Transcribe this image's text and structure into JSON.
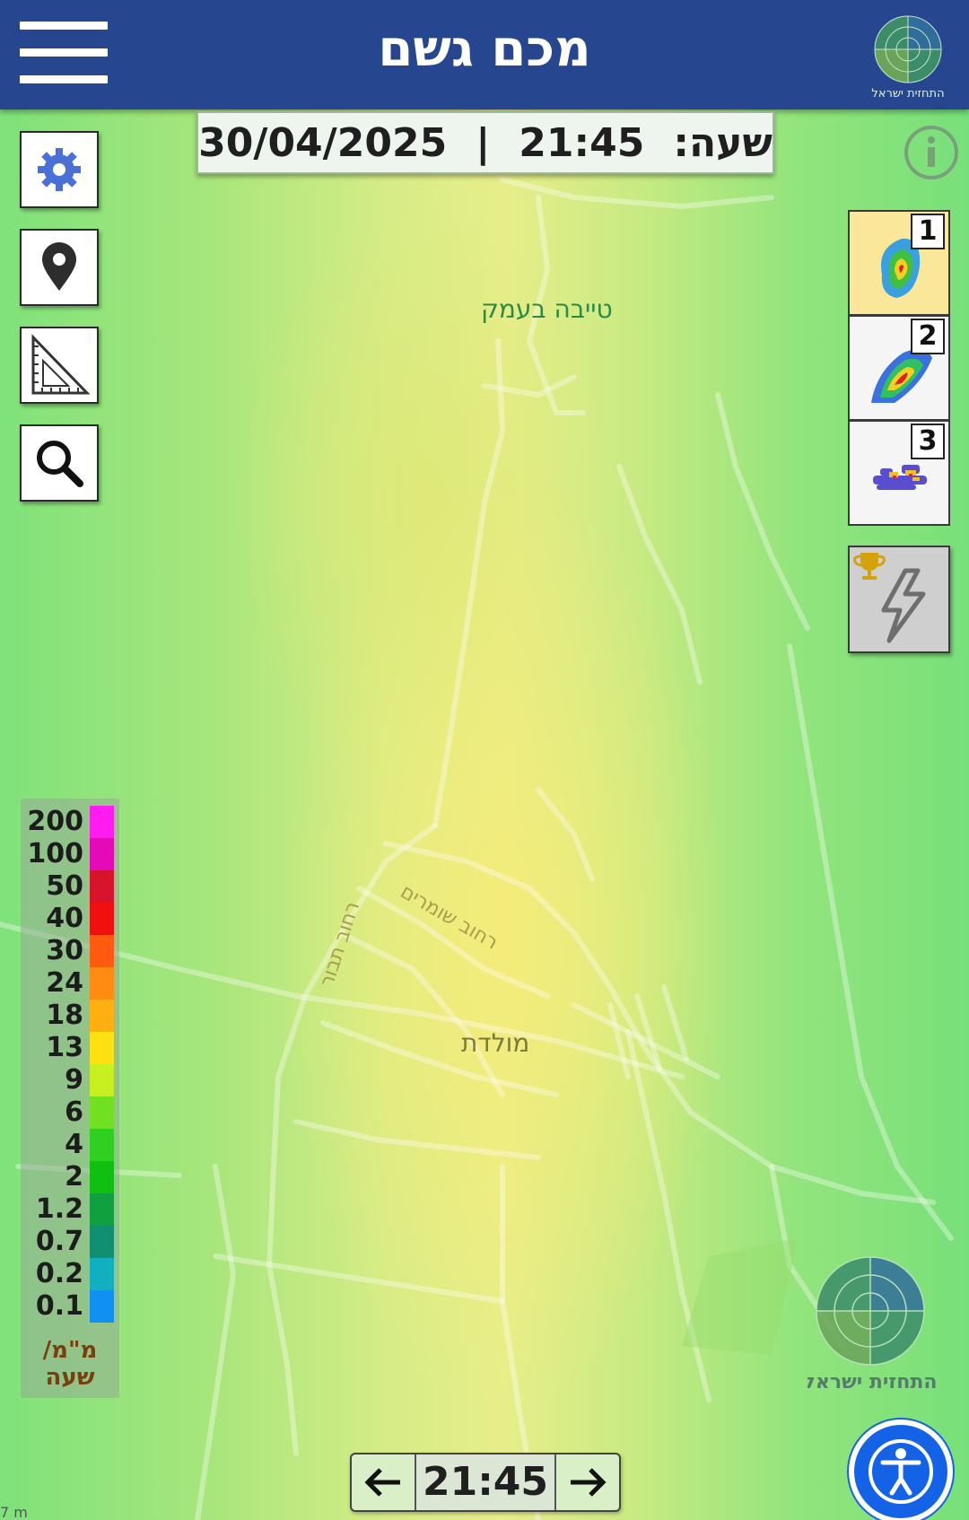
{
  "header": {
    "title": "מכם גשם",
    "logo_text": "התחזית ישראל"
  },
  "time_banner": {
    "hour_label": "שעה:",
    "time": "21:45",
    "separator": "|",
    "date": "30/04/2025"
  },
  "map": {
    "places": [
      {
        "label": "טייבה בעמק"
      },
      {
        "label": "מולדת"
      },
      {
        "label": "רחוב שומרים"
      },
      {
        "label": "רחוב תבור"
      }
    ],
    "scale_text": "7 m"
  },
  "tools": {
    "settings": "gear-icon",
    "location": "map-pin-icon",
    "measure": "ruler-triangle-icon",
    "search": "magnifier-icon"
  },
  "layers": [
    {
      "number": "1",
      "icon": "radar-map-icon",
      "selected": true
    },
    {
      "number": "2",
      "icon": "rain-map-icon",
      "selected": false
    },
    {
      "number": "3",
      "icon": "satellite-map-icon",
      "selected": false
    }
  ],
  "lightning": {
    "icon": "lightning-icon",
    "badge_icon": "trophy-icon"
  },
  "legend": {
    "values": [
      "200",
      "100",
      "50",
      "40",
      "30",
      "24",
      "18",
      "13",
      "9",
      "6",
      "4",
      "2",
      "1.2",
      "0.7",
      "0.2",
      "0.1"
    ],
    "colors": [
      "#ff1cf0",
      "#e40ab8",
      "#d8132c",
      "#f01010",
      "#ff5a10",
      "#ff8c10",
      "#ffb010",
      "#ffe010",
      "#c8f020",
      "#70e020",
      "#30d020",
      "#10c010",
      "#10a040",
      "#109070",
      "#10b0c0",
      "#1090f0"
    ],
    "unit": "מ\"מ/ שעה"
  },
  "stepper": {
    "time": "21:45",
    "prev_icon": "arrow-left-icon",
    "next_icon": "arrow-right-icon"
  },
  "watermark_text": "התחזית ישראל",
  "accessibility": {
    "icon": "accessibility-icon"
  }
}
